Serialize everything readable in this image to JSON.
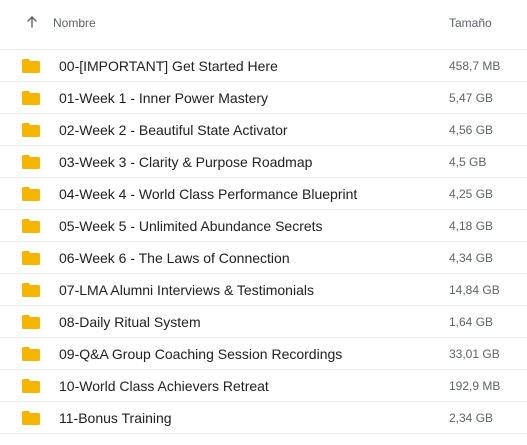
{
  "header": {
    "name_label": "Nombre",
    "size_label": "Tamaño",
    "sort_icon": "arrow-up-icon"
  },
  "colors": {
    "folder": "#f5b400",
    "folder_tab": "#e3a600",
    "divider": "#e8eaed"
  },
  "files": [
    {
      "name": "00-[IMPORTANT] Get Started Here",
      "size": "458,7 MB",
      "icon": "folder-icon"
    },
    {
      "name": "01-Week 1 - Inner Power Mastery",
      "size": "5,47 GB",
      "icon": "folder-icon"
    },
    {
      "name": "02-Week 2 - Beautiful State Activator",
      "size": "4,56 GB",
      "icon": "folder-icon"
    },
    {
      "name": "03-Week 3 - Clarity & Purpose Roadmap",
      "size": "4,5 GB",
      "icon": "folder-icon"
    },
    {
      "name": "04-Week 4 - World Class Performance Blueprint",
      "size": "4,25 GB",
      "icon": "folder-icon"
    },
    {
      "name": "05-Week 5 - Unlimited Abundance Secrets",
      "size": "4,18 GB",
      "icon": "folder-icon"
    },
    {
      "name": "06-Week 6 - The Laws of Connection",
      "size": "4,34 GB",
      "icon": "folder-icon"
    },
    {
      "name": "07-LMA Alumni Interviews & Testimonials",
      "size": "14,84 GB",
      "icon": "folder-icon"
    },
    {
      "name": "08-Daily Ritual System",
      "size": "1,64 GB",
      "icon": "folder-icon"
    },
    {
      "name": "09-Q&A Group Coaching Session Recordings",
      "size": "33,01 GB",
      "icon": "folder-icon"
    },
    {
      "name": "10-World Class Achievers Retreat",
      "size": "192,9 MB",
      "icon": "folder-icon"
    },
    {
      "name": "11-Bonus Training",
      "size": "2,34 GB",
      "icon": "folder-icon"
    }
  ]
}
